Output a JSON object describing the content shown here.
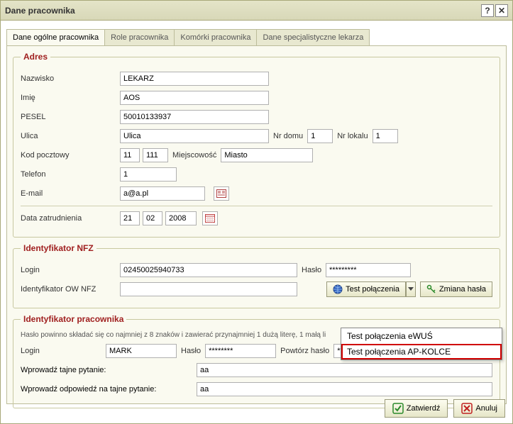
{
  "window": {
    "title": "Dane pracownika"
  },
  "tabs": [
    "Dane ogólne pracownika",
    "Role pracownika",
    "Komórki pracownika",
    "Dane specjalistyczne lekarza"
  ],
  "adres": {
    "legend": "Adres",
    "nazwisko_label": "Nazwisko",
    "nazwisko": "LEKARZ",
    "imie_label": "Imię",
    "imie": "AOS",
    "pesel_label": "PESEL",
    "pesel": "50010133937",
    "ulica_label": "Ulica",
    "ulica": "Ulica",
    "nrdomu_label": "Nr domu",
    "nrdomu": "1",
    "nrlokalu_label": "Nr lokalu",
    "nrlokalu": "1",
    "kod_label": "Kod pocztowy",
    "kod1": "11",
    "kod2": "111",
    "miejscowosc_label": "Miejscowość",
    "miejscowosc": "Miasto",
    "telefon_label": "Telefon",
    "telefon": "1",
    "email_label": "E-mail",
    "email": "a@a.pl",
    "data_zatr_label": "Data zatrudnienia",
    "dz_d": "21",
    "dz_m": "02",
    "dz_y": "2008"
  },
  "nfz": {
    "legend": "Identyfikator NFZ",
    "login_label": "Login",
    "login": "02450025940733",
    "haslo_label": "Hasło",
    "haslo": "*********",
    "idow_label": "Identyfikator OW NFZ",
    "idow": "",
    "test_btn": "Test połączenia",
    "zmiana_btn": "Zmiana hasła",
    "menu": {
      "item1": "Test połączenia eWUŚ",
      "item2": "Test połączenia AP-KOLCE"
    }
  },
  "idprac": {
    "legend": "Identyfikator pracownika",
    "hint": "Hasło powinno składać się co najmniej z 8 znaków i zawierać przynajmniej 1 dużą literę, 1 małą li",
    "login_label": "Login",
    "login": "MARK",
    "haslo_label": "Hasło",
    "haslo": "********",
    "powt_label": "Powtórz hasło",
    "powt": "********",
    "pyt_label": "Wprowadź tajne pytanie:",
    "pyt": "aa",
    "odp_label": "Wprowadź odpowiedź na tajne pytanie:",
    "odp": "aa"
  },
  "footer": {
    "zatwierdz": "Zatwierdź",
    "anuluj": "Anuluj"
  }
}
